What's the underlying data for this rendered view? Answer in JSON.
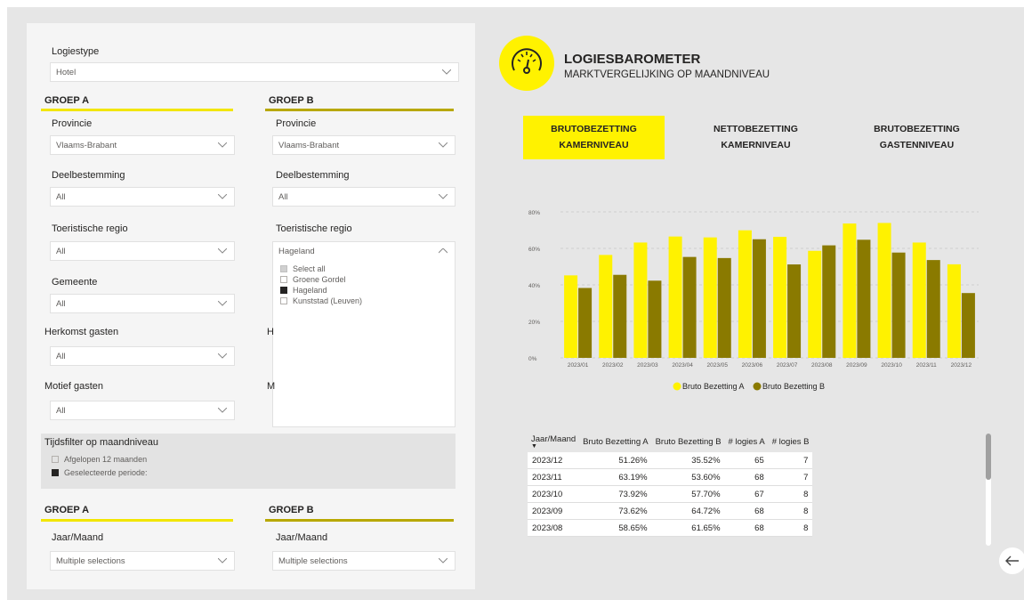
{
  "filters": {
    "logiestype": {
      "label": "Logiestype",
      "value": "Hotel"
    },
    "groep_a": {
      "title": "GROEP A",
      "provincie": {
        "label": "Provincie",
        "value": "Vlaams-Brabant"
      },
      "deelbestemming": {
        "label": "Deelbestemming",
        "value": "All"
      },
      "toeristische_regio": {
        "label": "Toeristische regio",
        "value": "All"
      },
      "gemeente": {
        "label": "Gemeente",
        "value": "All"
      }
    },
    "groep_b": {
      "title": "GROEP B",
      "provincie": {
        "label": "Provincie",
        "value": "Vlaams-Brabant"
      },
      "deelbestemming": {
        "label": "Deelbestemming",
        "value": "All"
      },
      "toeristische_regio": {
        "label": "Toeristische regio",
        "value": "Hageland"
      },
      "regio_options": [
        {
          "label": "Select all",
          "state": "partial"
        },
        {
          "label": "Groene Gordel",
          "state": "off"
        },
        {
          "label": "Hageland",
          "state": "on"
        },
        {
          "label": "Kunststad (Leuven)",
          "state": "off"
        }
      ],
      "herkomst_partial": "H",
      "motief_partial": "M"
    },
    "herkomst_gasten": {
      "label": "Herkomst gasten",
      "value": "All"
    },
    "motief_gasten": {
      "label": "Motief gasten",
      "value": "All"
    },
    "tijdsfilter": {
      "label": "Tijdsfilter op maandniveau",
      "options": [
        {
          "label": "Afgelopen 12 maanden",
          "state": "off"
        },
        {
          "label": "Geselecteerde periode:",
          "state": "on"
        }
      ]
    },
    "periode_a": {
      "title": "GROEP A",
      "label": "Jaar/Maand",
      "value": "Multiple selections"
    },
    "periode_b": {
      "title": "GROEP B",
      "label": "Jaar/Maand",
      "value": "Multiple selections"
    }
  },
  "header": {
    "title": "LOGIESBAROMETER",
    "subtitle": "MARKTVERGELIJKING OP MAANDNIVEAU",
    "icon": "gauge-icon"
  },
  "tabs": [
    {
      "line1": "BRUTOBEZETTING",
      "line2": "KAMERNIVEAU",
      "active": true
    },
    {
      "line1": "NETTOBEZETTING",
      "line2": "KAMERNIVEAU",
      "active": false
    },
    {
      "line1": "BRUTOBEZETTING",
      "line2": "GASTENNIVEAU",
      "active": false
    }
  ],
  "colors": {
    "series_a": "#fff200",
    "series_b": "#8a7a00",
    "accent": "#f2e600"
  },
  "chart_data": {
    "type": "bar",
    "categories": [
      "2023/01",
      "2023/02",
      "2023/03",
      "2023/04",
      "2023/05",
      "2023/06",
      "2023/07",
      "2023/08",
      "2023/09",
      "2023/10",
      "2023/11",
      "2023/12"
    ],
    "series": [
      {
        "name": "Bruto Bezetting A",
        "values": [
          45.2,
          56.4,
          63.2,
          66.5,
          66.0,
          69.9,
          66.3,
          58.65,
          73.62,
          73.92,
          63.19,
          51.26
        ]
      },
      {
        "name": "Bruto Bezetting B",
        "values": [
          38.3,
          45.5,
          42.3,
          55.3,
          54.7,
          65.0,
          51.2,
          61.65,
          64.72,
          57.7,
          53.6,
          35.52
        ]
      }
    ],
    "yticks": [
      "0%",
      "20%",
      "40%",
      "60%",
      "80%"
    ],
    "ylim": [
      0,
      80
    ],
    "grid": true,
    "legend": "bottom-center"
  },
  "table": {
    "columns": [
      "Jaar/Maand",
      "Bruto Bezetting A",
      "Bruto Bezetting B",
      "# logies A",
      "# logies B"
    ],
    "rows": [
      [
        "2023/12",
        "51.26%",
        "35.52%",
        "65",
        "7"
      ],
      [
        "2023/11",
        "63.19%",
        "53.60%",
        "68",
        "7"
      ],
      [
        "2023/10",
        "73.92%",
        "57.70%",
        "67",
        "8"
      ],
      [
        "2023/09",
        "73.62%",
        "64.72%",
        "68",
        "8"
      ],
      [
        "2023/08",
        "58.65%",
        "61.65%",
        "68",
        "8"
      ]
    ]
  },
  "nav": {
    "back_icon": "back-arrow-icon"
  }
}
